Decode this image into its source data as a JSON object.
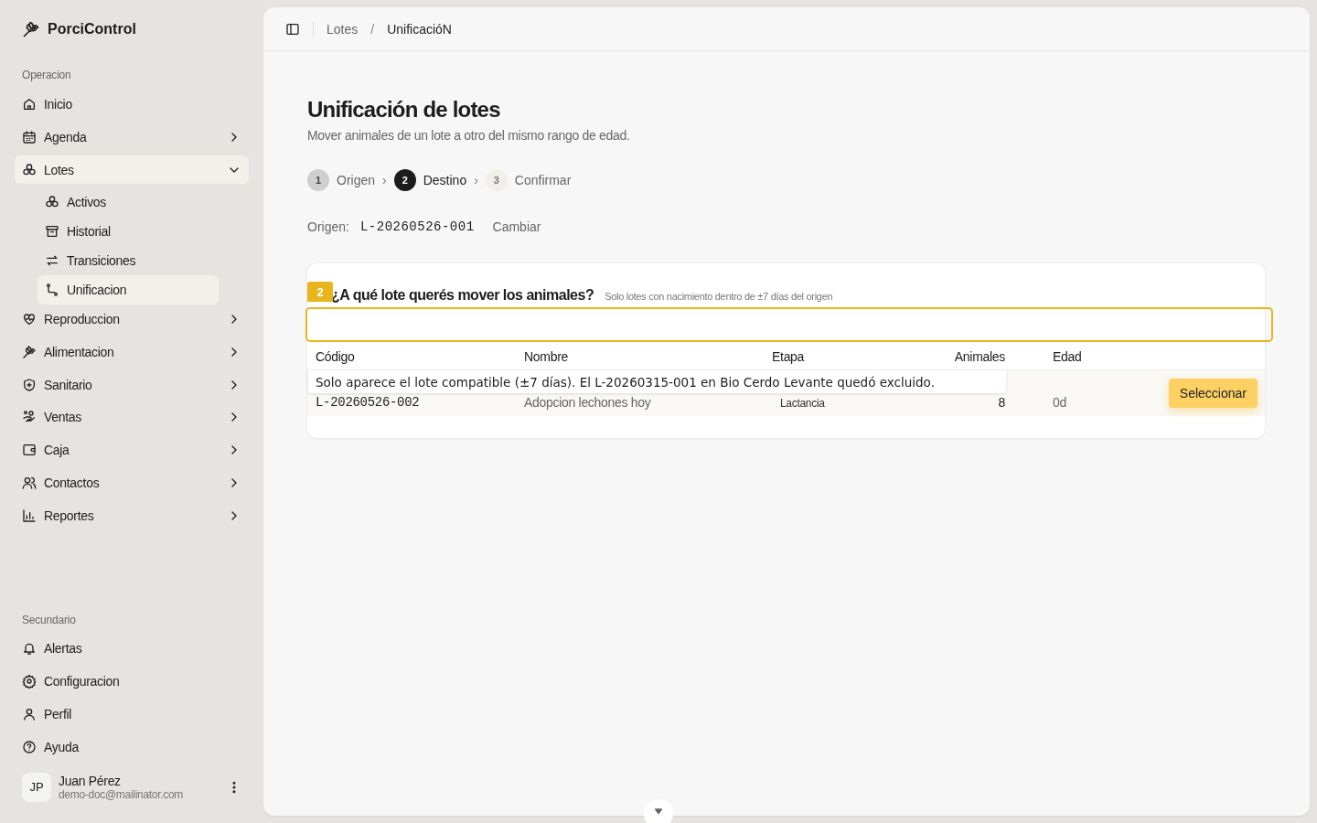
{
  "sidebar": {
    "brand": "PorciControl",
    "sections": [
      {
        "label": "Operacion",
        "items": [
          {
            "label": "Inicio",
            "selected": false
          },
          {
            "label": "Agenda",
            "selected": false,
            "expanded": false
          },
          {
            "label": "Lotes",
            "selected": true,
            "expanded": true,
            "children": [
              {
                "label": "Activos",
                "selected": false
              },
              {
                "label": "Historial",
                "selected": false
              },
              {
                "label": "Transiciones",
                "selected": false
              },
              {
                "label": "Unificacion",
                "selected": true
              }
            ]
          },
          {
            "label": "Reproduccion",
            "selected": false,
            "expanded": false
          },
          {
            "label": "Alimentacion",
            "selected": false,
            "expanded": false
          },
          {
            "label": "Sanitario",
            "selected": false,
            "expanded": false
          },
          {
            "label": "Ventas",
            "selected": false,
            "expanded": false
          },
          {
            "label": "Caja",
            "selected": false,
            "expanded": false
          },
          {
            "label": "Contactos",
            "selected": false,
            "expanded": false
          },
          {
            "label": "Reportes",
            "selected": false,
            "expanded": false
          }
        ]
      },
      {
        "label": "Secundario",
        "items": [
          {
            "label": "Alertas",
            "selected": false
          },
          {
            "label": "Configuracion",
            "selected": false
          },
          {
            "label": "Perfil",
            "selected": false
          },
          {
            "label": "Ayuda",
            "selected": false
          }
        ]
      }
    ],
    "user": {
      "initials": "JP",
      "name": "Juan Pérez",
      "email": "demo-doc@mailinator.com"
    }
  },
  "breadcrumb": {
    "items": [
      "Lotes",
      "UnificacióN"
    ],
    "separator": "/"
  },
  "page": {
    "title": "Unificación de lotes",
    "subtitle": "Mover animales de un lote a otro del mismo rango de edad.",
    "steps": [
      {
        "number": "1",
        "label": "Origen",
        "kind": "done"
      },
      {
        "number": "2",
        "label": "Destino",
        "kind": "current"
      },
      {
        "number": "3",
        "label": "Confirmar",
        "kind": "upcoming"
      }
    ],
    "step_separators": [
      "›",
      "›"
    ],
    "origin": {
      "label": "Origen:",
      "code": "L-20260526-001",
      "action": "Cambiar"
    },
    "card": {
      "title": "¿A qué lote querés mover los animales?",
      "hint": "Solo lotes con nacimiento dentro de ±7 días del origen",
      "columns": [
        "Código",
        "Nombre",
        "Etapa",
        "Animales",
        "Edad"
      ],
      "rows": [
        {
          "code": "L-20260526-002",
          "name": "Adopcion lechones hoy",
          "stage": "Lactancia",
          "animals": "8",
          "age": "0d",
          "action": "Seleccionar"
        }
      ]
    }
  },
  "tour": {
    "badge": "2",
    "tooltip": "Solo aparece el lote compatible (±7 días). El L-20260315-001 en Bio Cerdo Levante quedó excluido."
  }
}
